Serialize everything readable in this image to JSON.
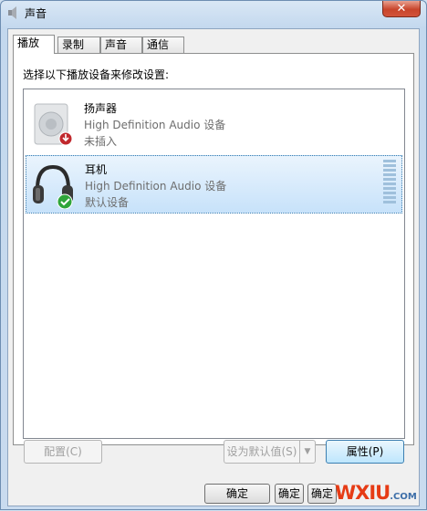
{
  "window": {
    "title": "声音",
    "close_glyph": "✕"
  },
  "tabs": [
    {
      "label": "播放",
      "active": true
    },
    {
      "label": "录制",
      "active": false
    },
    {
      "label": "声音",
      "active": false
    },
    {
      "label": "通信",
      "active": false
    }
  ],
  "instruction": "选择以下播放设备来修改设置:",
  "devices": [
    {
      "name": "扬声器",
      "driver": "High Definition Audio 设备",
      "status": "未插入",
      "icon": "speaker-icon",
      "badge": "unplugged-badge-icon",
      "selected": false
    },
    {
      "name": "耳机",
      "driver": "High Definition Audio 设备",
      "status": "默认设备",
      "icon": "headphones-icon",
      "badge": "default-check-badge-icon",
      "selected": true
    }
  ],
  "buttons": {
    "configure": "配置(C)",
    "set_default": "设为默认值(S)",
    "properties": "属性(P)",
    "ok": "确定",
    "ok2": "确定",
    "ok3": "确定"
  },
  "watermark": {
    "brand": "WXIU",
    "domain": ".COM"
  },
  "colors": {
    "accent": "#3c7fb1",
    "close": "#c8452b",
    "check": "#2fa53a",
    "unplugged": "#c0282d"
  }
}
